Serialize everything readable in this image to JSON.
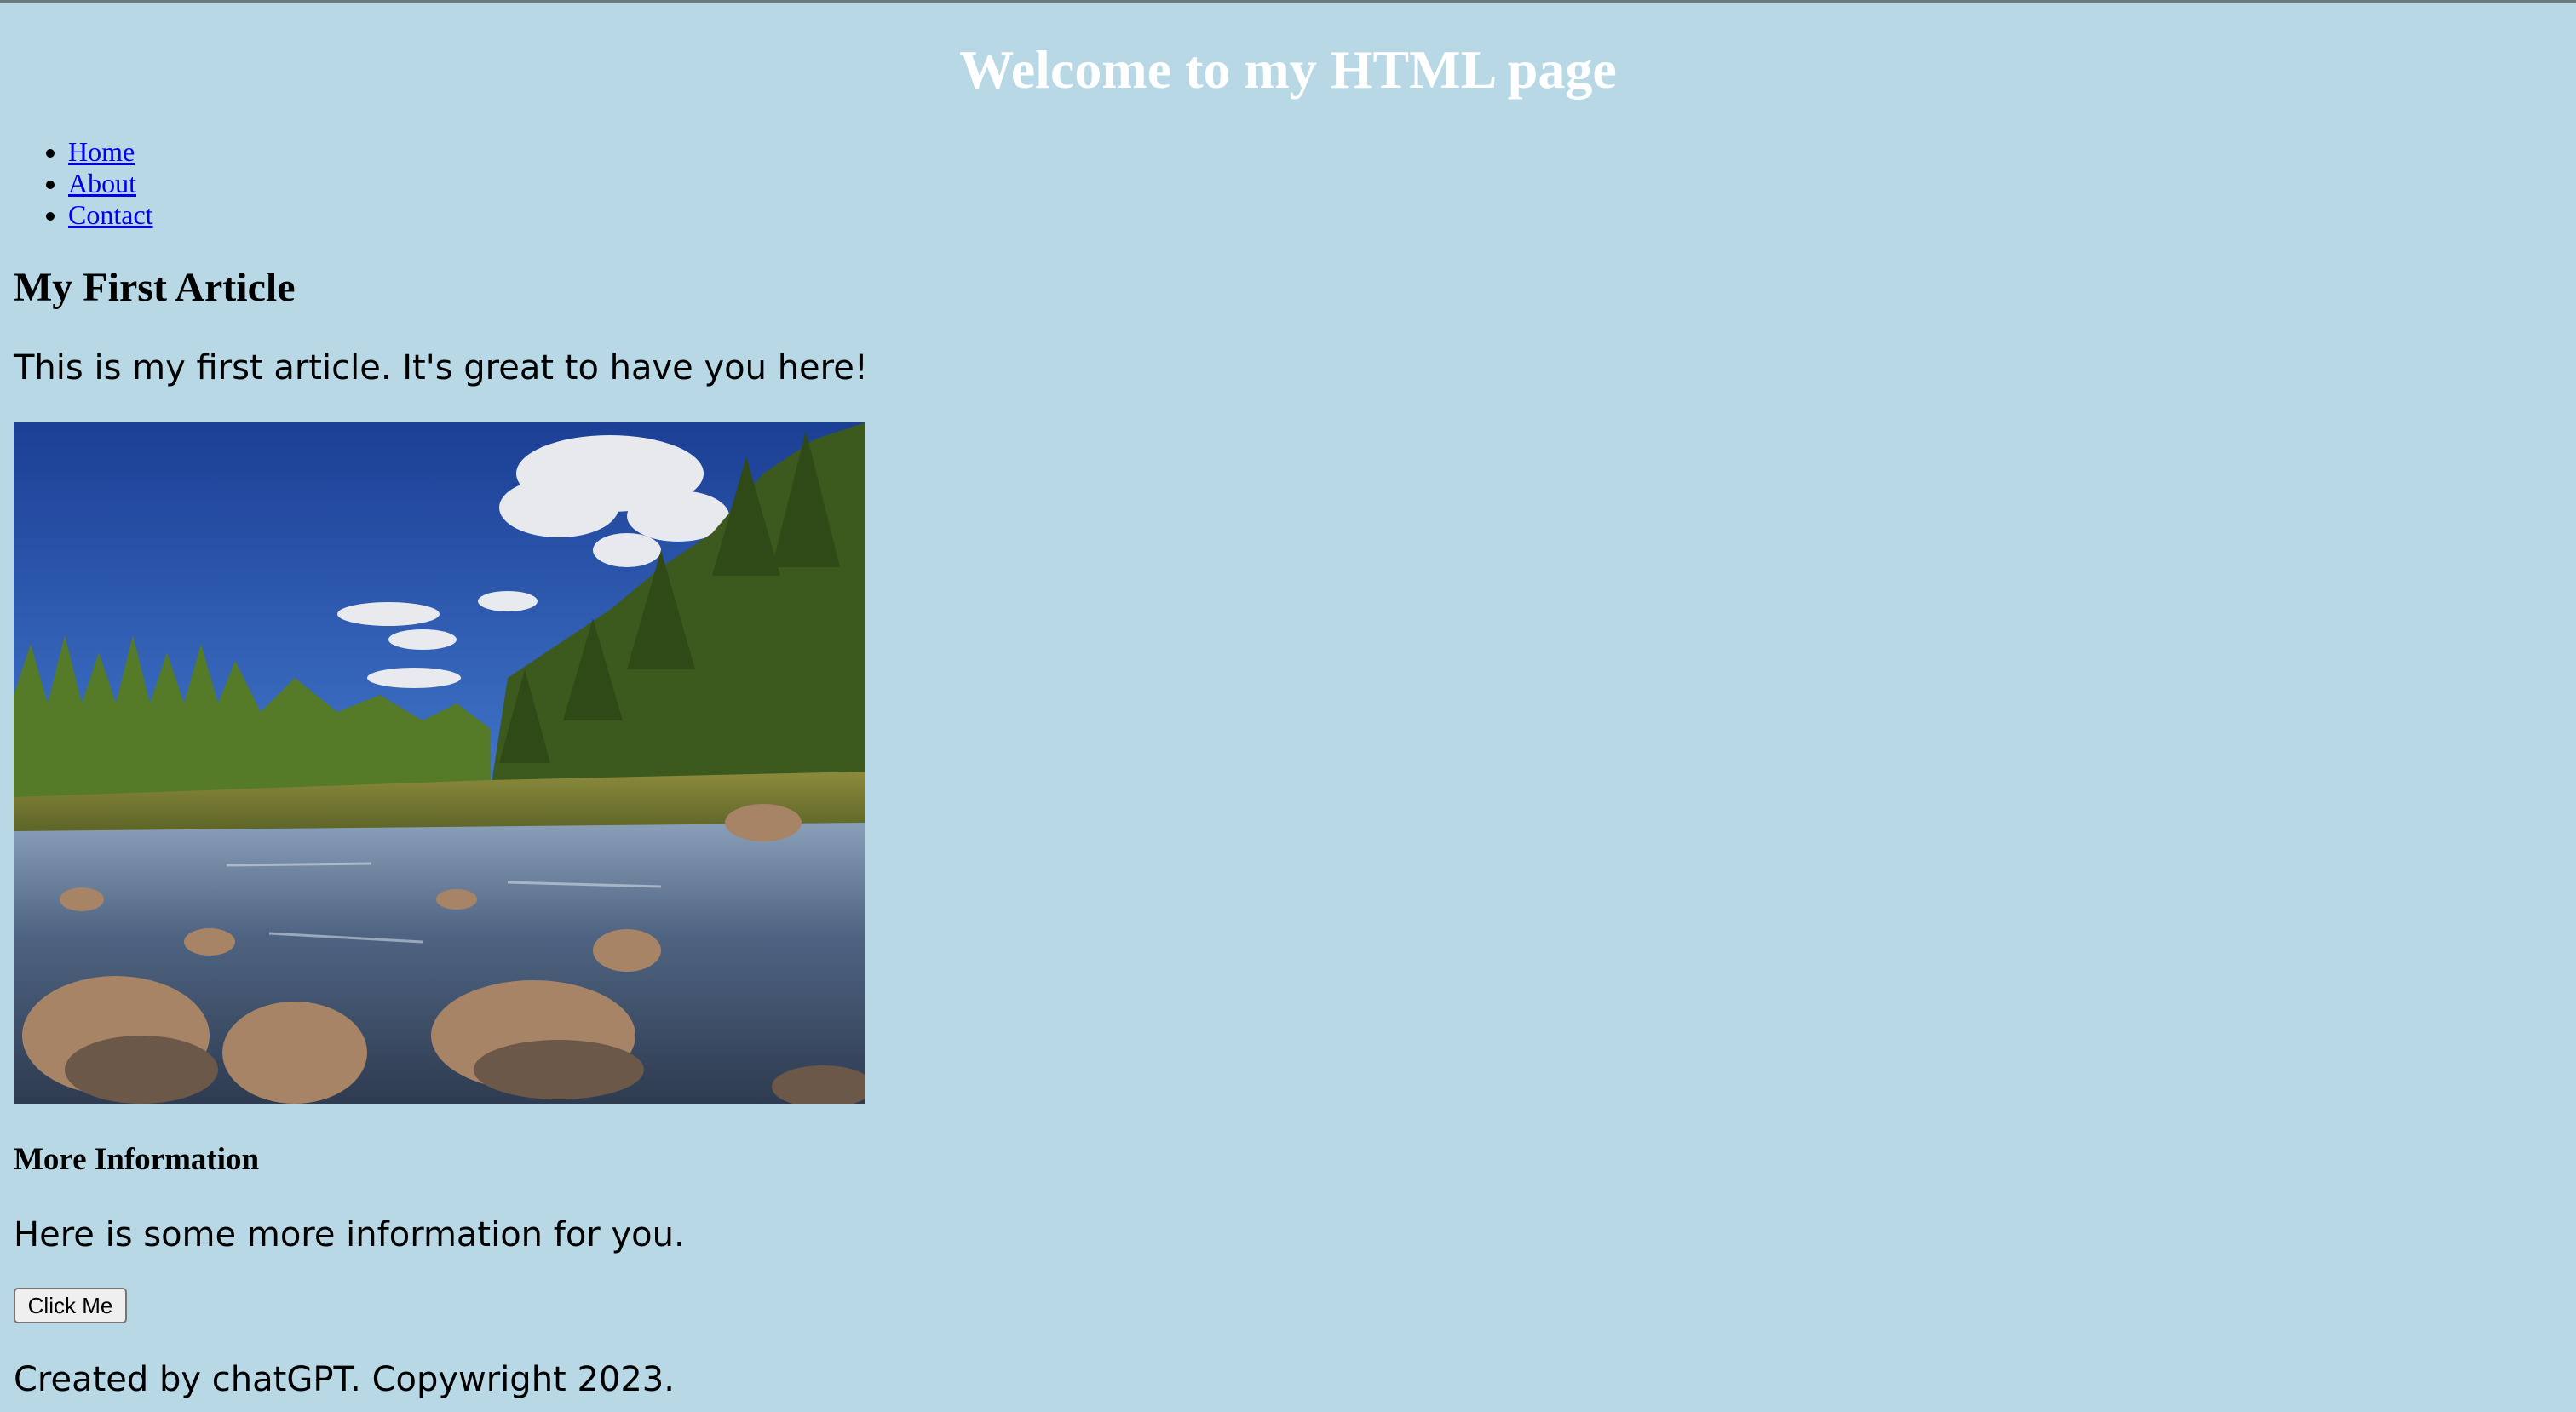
{
  "header": {
    "title": "Welcome to my HTML page"
  },
  "nav": {
    "items": [
      {
        "label": "Home"
      },
      {
        "label": "About"
      },
      {
        "label": "Contact"
      }
    ]
  },
  "article": {
    "title": "My First Article",
    "text": "This is my first article. It's great to have you here!",
    "image": "mountain-river-landscape-photo"
  },
  "more_info": {
    "title": "More Information",
    "text": "Here is some more information for you.",
    "button_label": "Click Me"
  },
  "footer": {
    "text": "Created by chatGPT. Copywright 2023."
  },
  "colors": {
    "background": "#b7d8e4",
    "title": "#ffffff",
    "link": "#0000ee"
  }
}
